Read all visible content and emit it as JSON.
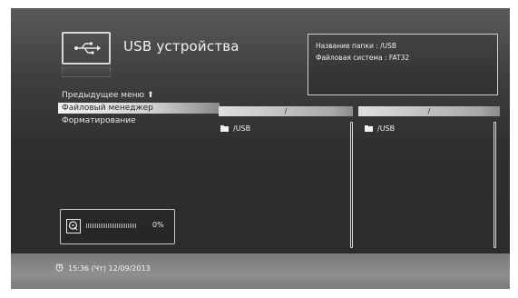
{
  "header": {
    "title": "USB устройства",
    "icon": "usb-icon"
  },
  "info": {
    "folder_name": "Название папки : /USB",
    "file_system": "Файловая система : FAT32"
  },
  "menu": {
    "items": [
      {
        "label": "Предыдущее меню",
        "icon": "arrow-up-icon"
      },
      {
        "label": "Файловый менеджер",
        "selected": true
      },
      {
        "label": "Форматирование"
      }
    ]
  },
  "panes": {
    "left": {
      "path": "/",
      "folder": "/USB"
    },
    "right": {
      "path": "/",
      "folder": "/USB"
    }
  },
  "progress": {
    "icon": "disk-icon",
    "fraction": 0.0,
    "percent_text": "0%"
  },
  "status": {
    "clock_icon": "clock-icon",
    "datetime": "15:36 (Чт) 12/09/2013"
  },
  "colors": {
    "background_top": "#5a5a5a",
    "background_bottom": "#2a2a2a",
    "bottom_band": "#8a8a8a",
    "highlight": "#e0e0e0"
  }
}
